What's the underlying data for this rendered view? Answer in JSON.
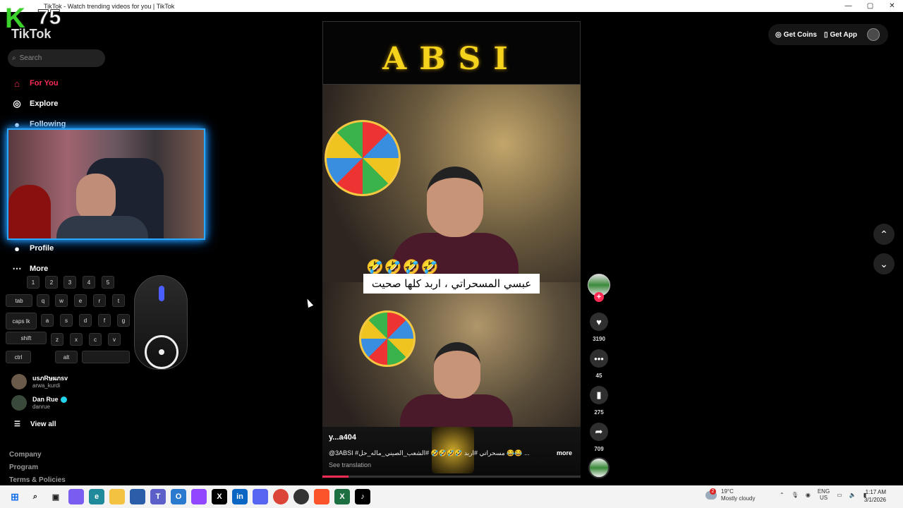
{
  "window": {
    "title": "TikTok - Watch trending videos for you | TikTok",
    "controls": [
      "—",
      "▢",
      "✕"
    ]
  },
  "overlay": {
    "logo_letter": "K",
    "logo_number": "75"
  },
  "sidebar": {
    "brand": "TikTok",
    "search_placeholder": "Search",
    "nav": [
      {
        "label": "For You",
        "icon": "home-icon"
      },
      {
        "label": "Explore",
        "icon": "compass-icon"
      },
      {
        "label": "Following",
        "icon": "following-icon"
      },
      {
        "label": "Profile",
        "icon": "profile-icon"
      },
      {
        "label": "More",
        "icon": "more-icon"
      }
    ],
    "accounts": [
      {
        "name": "usภRษผภsv",
        "handle": "arwa_kurdi"
      },
      {
        "name": "Dan Rue",
        "handle": "danrue",
        "verified": true
      }
    ],
    "view_all": "View all",
    "footer": [
      "Company",
      "Program",
      "Terms & Policies"
    ]
  },
  "keyboard_overlay": {
    "numbers": [
      "1",
      "2",
      "3",
      "4",
      "5"
    ],
    "row1": [
      "tab",
      "q",
      "w",
      "e",
      "r",
      "t"
    ],
    "row2": [
      "caps lk",
      "a",
      "s",
      "d",
      "f",
      "g"
    ],
    "row3": [
      "shift",
      "z",
      "x",
      "c",
      "v"
    ],
    "row4": [
      "ctrl",
      "alt"
    ]
  },
  "video": {
    "banner_text": "ABSI",
    "emojis": "🤣🤣🤣🤣",
    "caption": "عبسي المسحراتي ، اربد كلها صحيت",
    "author": "y...a404",
    "description": "@3ABSI #مسحراتي #اربد 🤣🤣🤣🤣 #الشعب_الصيني_ماله_حل 😂😂 ...",
    "more_label": "more",
    "see_translation": "See translation",
    "progress_fraction": 0.1
  },
  "actions": {
    "likes": "3190",
    "comments": "45",
    "saves": "275",
    "shares": "709"
  },
  "header": {
    "get_coins": "Get Coins",
    "get_app": "Get App"
  },
  "taskbar": {
    "weather_temp": "19°C",
    "weather_desc": "Mostly cloudy",
    "weather_badge": "2",
    "lang": "ENG",
    "region": "US",
    "time": "1:17 AM",
    "date": "3/1/2026"
  }
}
